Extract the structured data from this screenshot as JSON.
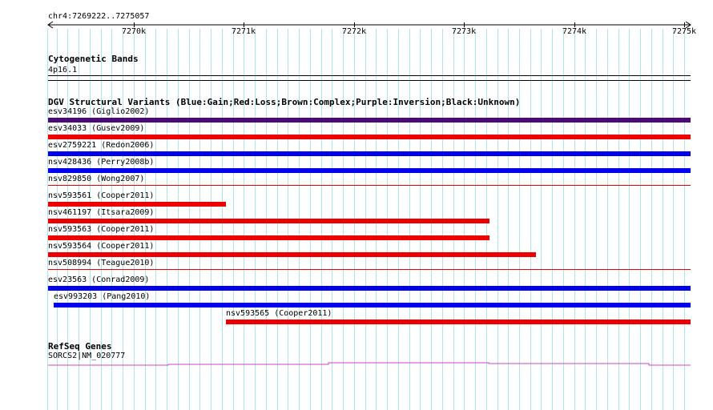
{
  "ruler": {
    "position_label": "chr4:7269222..7275057",
    "ticks": [
      "7270k",
      "7271k",
      "7272k",
      "7273k",
      "7274k",
      "7275k"
    ]
  },
  "cytoband": {
    "title": "Cytogenetic Bands",
    "band": "4p16.1"
  },
  "dgv": {
    "title": "DGV Structural Variants (Blue:Gain;Red:Loss;Brown:Complex;Purple:Inversion;Black:Unknown)",
    "colors": {
      "gain": "#0000ee",
      "loss": "#ee0000",
      "inversion": "#4b0a7a"
    },
    "variants": [
      {
        "label": "esv34196 (Giglio2002)",
        "type": "inversion",
        "start": 7269222,
        "end": 7275057
      },
      {
        "label": "esv34033 (Gusev2009)",
        "type": "loss",
        "start": 7269222,
        "end": 7275057
      },
      {
        "label": "esv2759221 (Redon2006)",
        "type": "gain",
        "start": 7269222,
        "end": 7275057
      },
      {
        "label": "nsv428436 (Perry2008b)",
        "type": "gain",
        "start": 7269222,
        "end": 7275057
      },
      {
        "label": "nsv829850 (Wong2007)",
        "type": "loss",
        "start": 7269222,
        "end": 7275057
      },
      {
        "label": "nsv593561 (Cooper2011)",
        "type": "loss",
        "start": 7269222,
        "end": 7270840
      },
      {
        "label": "nsv461197 (Itsara2009)",
        "type": "loss",
        "start": 7269222,
        "end": 7273230
      },
      {
        "label": "nsv593563 (Cooper2011)",
        "type": "loss",
        "start": 7269222,
        "end": 7273230
      },
      {
        "label": "nsv593564 (Cooper2011)",
        "type": "loss",
        "start": 7269222,
        "end": 7273650
      },
      {
        "label": "nsv508994 (Teague2010)",
        "type": "loss",
        "start": 7269222,
        "end": 7275057
      },
      {
        "label": "esv23563 (Conrad2009)",
        "type": "gain",
        "start": 7269222,
        "end": 7275057
      },
      {
        "label": "esv993203 (Pang2010)",
        "type": "gain",
        "start": 7269270,
        "end": 7275057
      },
      {
        "label": "nsv593565 (Cooper2011)",
        "type": "loss",
        "start": 7270840,
        "end": 7275057
      }
    ]
  },
  "refseq": {
    "title": "RefSeq Genes",
    "gene_label": "SORCS2|NM_020777",
    "color": "#cc44cc"
  }
}
